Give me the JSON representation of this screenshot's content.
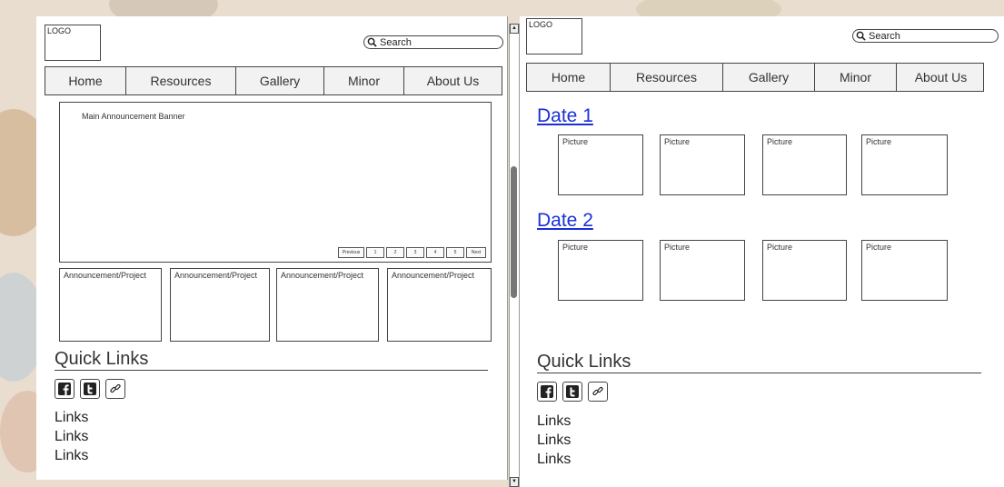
{
  "left": {
    "logo": "LOGO",
    "search_placeholder": "Search",
    "nav": [
      "Home",
      "Resources",
      "Gallery",
      "Minor",
      "About Us"
    ],
    "banner": "Main Announcement Banner",
    "pager": [
      "Previous",
      "1",
      "2",
      "3",
      "4",
      "5",
      "Next"
    ],
    "announcements": [
      "Announcement/Project",
      "Announcement/Project",
      "Announcement/Project",
      "Announcement/Project"
    ],
    "quick_links_title": "Quick Links",
    "links": [
      "Links",
      "Links",
      "Links"
    ]
  },
  "right": {
    "logo": "LOGO",
    "search_placeholder": "Search",
    "nav": [
      "Home",
      "Resources",
      "Gallery",
      "Minor",
      "About Us"
    ],
    "dates": [
      {
        "label": "Date 1",
        "pictures": [
          "Picture",
          "Picture",
          "Picture",
          "Picture"
        ]
      },
      {
        "label": "Date 2",
        "pictures": [
          "Picture",
          "Picture",
          "Picture",
          "Picture"
        ]
      }
    ],
    "quick_links_title": "Quick Links",
    "links": [
      "Links",
      "Links",
      "Links"
    ]
  },
  "icons": [
    "facebook-icon",
    "twitter-icon",
    "link-icon",
    "search-icon"
  ]
}
